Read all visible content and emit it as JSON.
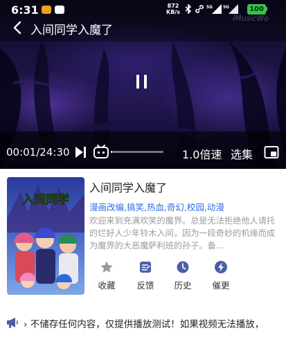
{
  "status_bar": {
    "time": "6:31",
    "net_speed_value": "872",
    "net_speed_unit": "KB/s",
    "battery": "100"
  },
  "player": {
    "title": "入间同学入魔了",
    "watermark": "iMusicWo",
    "current_time": "00:01",
    "duration": "24:30",
    "time_separator": "/",
    "progress": 0.0007,
    "speed_label": "1.0倍速",
    "episodes_label": "选集"
  },
  "info": {
    "title": "入间同学入魔了",
    "tags": "漫画改编,搞笑,热血,奇幻,校园,动漫",
    "synopsis": "欢迎来到充满欢笑的魔界。总是无法拒绝他人请托的烂好人少年铃木入间，因为一段奇妙的机缘而成为魔界的大恶魔萨利班的孙子。备...",
    "cover_title": "入间同学"
  },
  "actions": [
    {
      "label": "收藏",
      "icon": "star-icon"
    },
    {
      "label": "反馈",
      "icon": "feedback-icon"
    },
    {
      "label": "历史",
      "icon": "clock-icon"
    },
    {
      "label": "催更",
      "icon": "lightning-icon"
    }
  ],
  "notice": {
    "text": "› 不储存任何内容，仅提供播放测试！如果视频无法播放，"
  },
  "colors": {
    "accent": "#2f6ee0",
    "icon_blue": "#4a5fa8",
    "star_gray": "#9a9a9a",
    "battery_green": "#35c64a"
  }
}
